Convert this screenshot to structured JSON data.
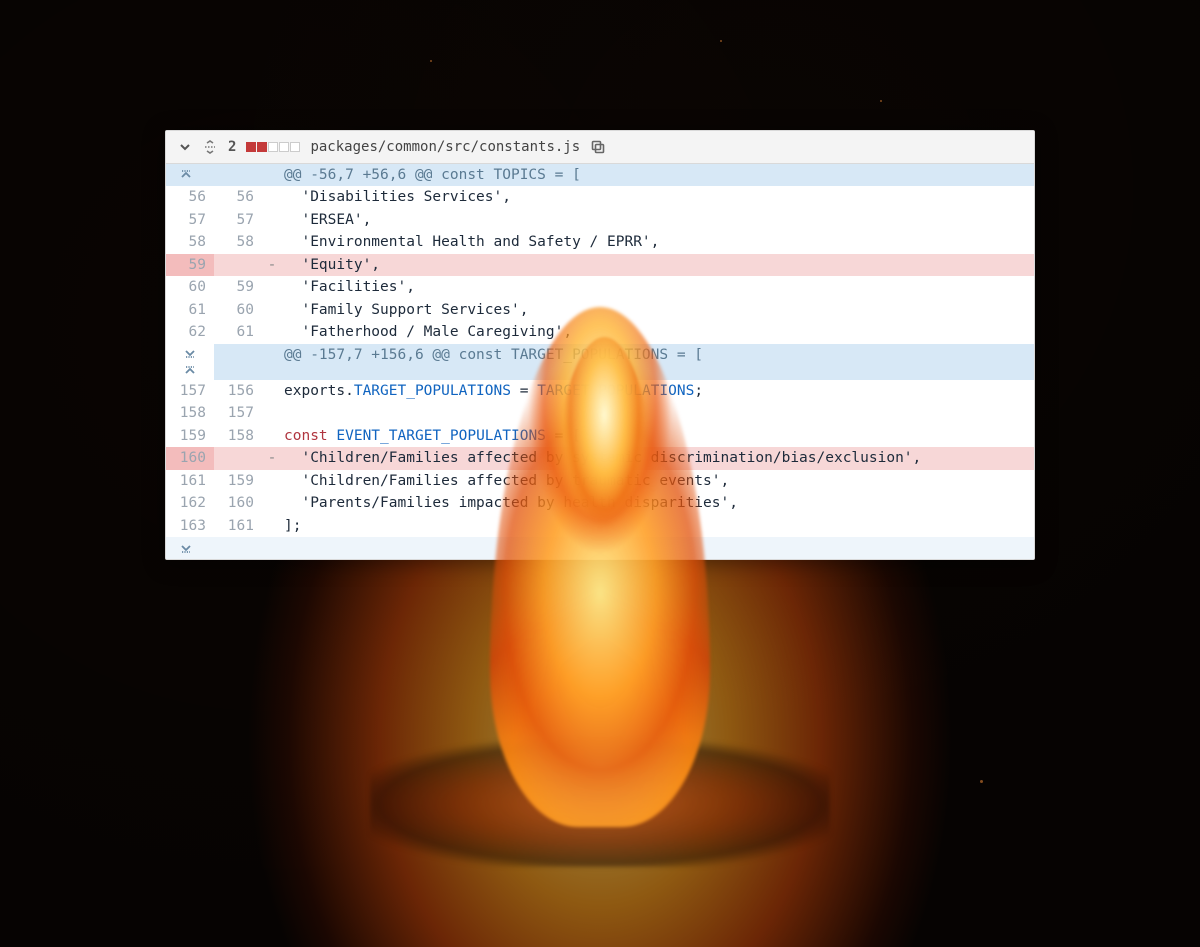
{
  "header": {
    "change_count": "2",
    "diff_squares": [
      "del",
      "del",
      "empty",
      "empty",
      "empty"
    ],
    "file_path": "packages/common/src/constants.js"
  },
  "hunks": [
    {
      "header": "@@ -56,7 +56,6 @@ const TOPICS = ["
    },
    {
      "header": "@@ -157,7 +156,6 @@ const TARGET_POPULATIONS = ["
    }
  ],
  "rows1": [
    {
      "type": "ctx",
      "old": "56",
      "new": "56",
      "code": "  'Disabilities Services',"
    },
    {
      "type": "ctx",
      "old": "57",
      "new": "57",
      "code": "  'ERSEA',"
    },
    {
      "type": "ctx",
      "old": "58",
      "new": "58",
      "code": "  'Environmental Health and Safety / EPRR',"
    },
    {
      "type": "del",
      "old": "59",
      "new": "",
      "code": "  'Equity',"
    },
    {
      "type": "ctx",
      "old": "60",
      "new": "59",
      "code": "  'Facilities',"
    },
    {
      "type": "ctx",
      "old": "61",
      "new": "60",
      "code": "  'Family Support Services',"
    },
    {
      "type": "ctx",
      "old": "62",
      "new": "61",
      "code": "  'Fatherhood / Male Caregiving',"
    }
  ],
  "rows2": [
    {
      "type": "ctx",
      "old": "157",
      "new": "156",
      "code_parts": [
        "exports.",
        [
          "var",
          "TARGET_POPULATIONS"
        ],
        " = ",
        [
          "var",
          "TARGET_POPULATIONS"
        ],
        ";"
      ]
    },
    {
      "type": "ctx",
      "old": "158",
      "new": "157",
      "code": ""
    },
    {
      "type": "ctx",
      "old": "159",
      "new": "158",
      "code_parts": [
        [
          "key",
          "const"
        ],
        " ",
        [
          "var",
          "EVENT_TARGET_POPULATIONS"
        ],
        " = ["
      ]
    },
    {
      "type": "del",
      "old": "160",
      "new": "",
      "code": "  'Children/Families affected by systemic discrimination/bias/exclusion',"
    },
    {
      "type": "ctx",
      "old": "161",
      "new": "159",
      "code": "  'Children/Families affected by traumatic events',"
    },
    {
      "type": "ctx",
      "old": "162",
      "new": "160",
      "code": "  'Parents/Families impacted by health disparities',"
    },
    {
      "type": "ctx",
      "old": "163",
      "new": "161",
      "code": "];"
    }
  ]
}
